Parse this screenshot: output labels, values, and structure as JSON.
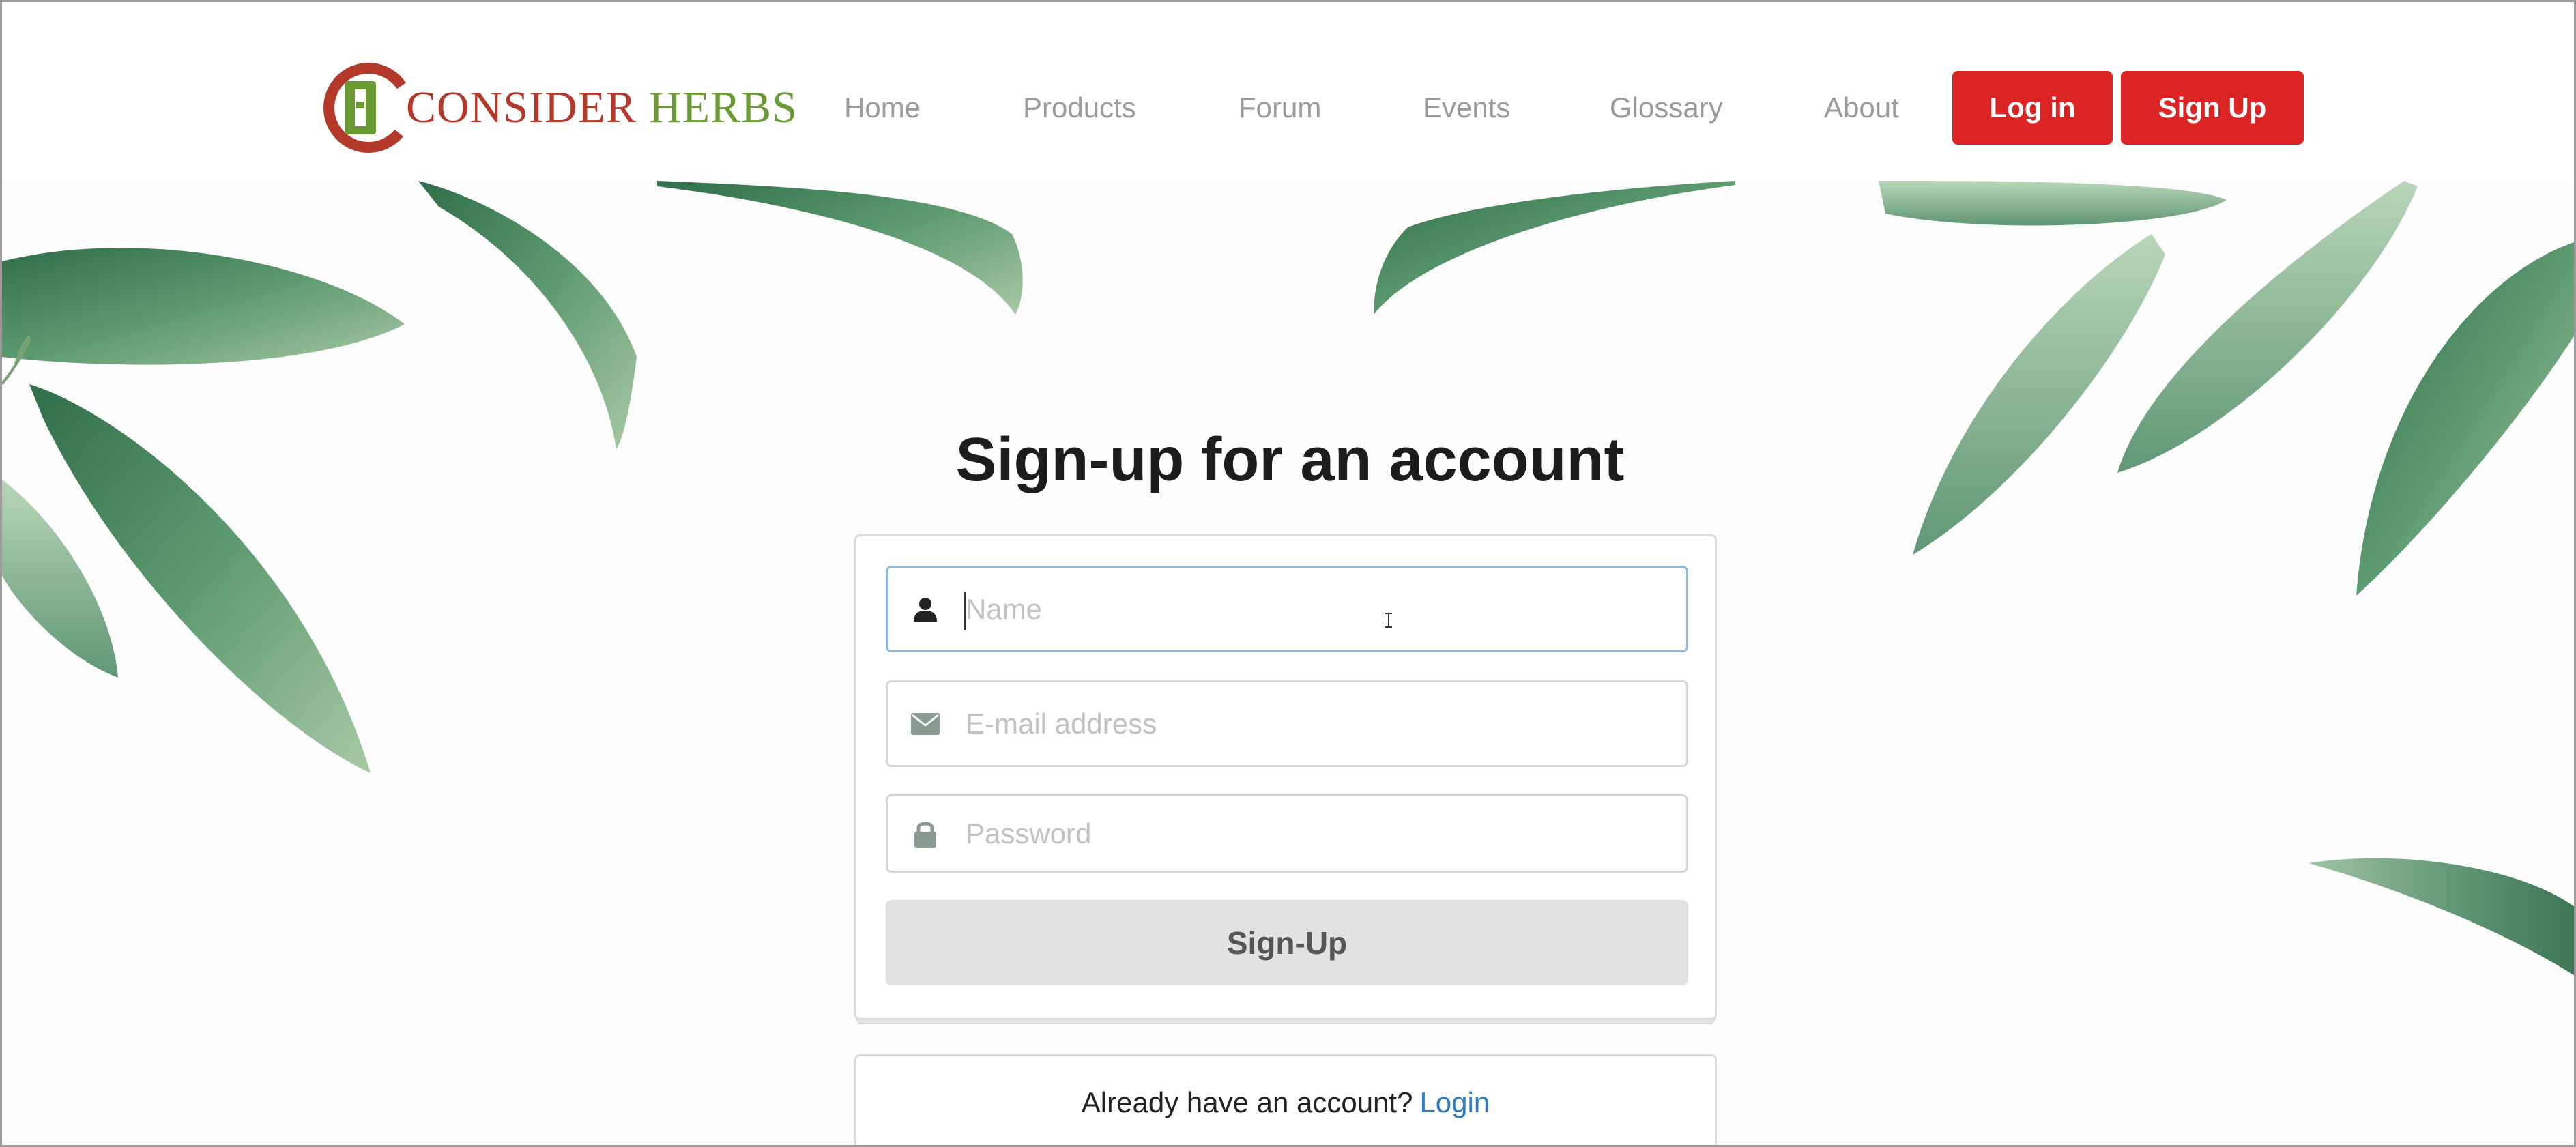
{
  "brand": {
    "name_part1": "CONSIDER",
    "name_part2": "HERBS",
    "primary_color": "#b33a2a",
    "secondary_color": "#6a9a33"
  },
  "nav": {
    "items": [
      "Home",
      "Products",
      "Forum",
      "Events",
      "Glossary",
      "About"
    ],
    "login_label": "Log in",
    "signup_label": "Sign Up",
    "button_color": "#db2525"
  },
  "form": {
    "title": "Sign-up for an account",
    "name_field": {
      "placeholder": "Name",
      "value": "",
      "icon": "user-icon"
    },
    "email_field": {
      "placeholder": "E-mail address",
      "value": "",
      "icon": "envelope-icon"
    },
    "password_field": {
      "placeholder": "Password",
      "value": "",
      "icon": "lock-icon"
    },
    "submit_label": "Sign-Up"
  },
  "footer_message": {
    "text": "Already have an account?",
    "link_label": "Login",
    "link_color": "#2f7bbf"
  }
}
